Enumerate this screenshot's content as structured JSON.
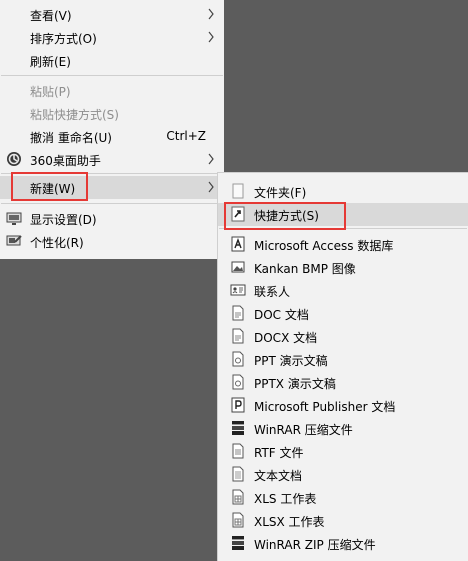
{
  "main_menu": {
    "items": [
      {
        "label": "查看(V)"
      },
      {
        "label": "排序方式(O)"
      },
      {
        "label": "刷新(E)"
      },
      {
        "label": "粘贴(P)"
      },
      {
        "label": "粘贴快捷方式(S)"
      },
      {
        "label": "撤消 重命名(U)",
        "shortcut": "Ctrl+Z"
      },
      {
        "label": "360桌面助手"
      },
      {
        "label": "新建(W)"
      },
      {
        "label": "显示设置(D)"
      },
      {
        "label": "个性化(R)"
      }
    ]
  },
  "sub_menu": {
    "items": [
      {
        "label": "文件夹(F)"
      },
      {
        "label": "快捷方式(S)"
      },
      {
        "label": "Microsoft Access 数据库"
      },
      {
        "label": "Kankan BMP 图像"
      },
      {
        "label": "联系人"
      },
      {
        "label": "DOC 文档"
      },
      {
        "label": "DOCX 文档"
      },
      {
        "label": "PPT 演示文稿"
      },
      {
        "label": "PPTX 演示文稿"
      },
      {
        "label": "Microsoft Publisher 文档"
      },
      {
        "label": "WinRAR 压缩文件"
      },
      {
        "label": "RTF 文件"
      },
      {
        "label": "文本文档"
      },
      {
        "label": "XLS 工作表"
      },
      {
        "label": "XLSX 工作表"
      },
      {
        "label": "WinRAR ZIP 压缩文件"
      }
    ]
  },
  "colors": {
    "highlight_box": "#e53935",
    "hover": "#d9d9d9",
    "menu_bg": "#f2f2f2",
    "desktop_bg": "#5c5c5c"
  }
}
